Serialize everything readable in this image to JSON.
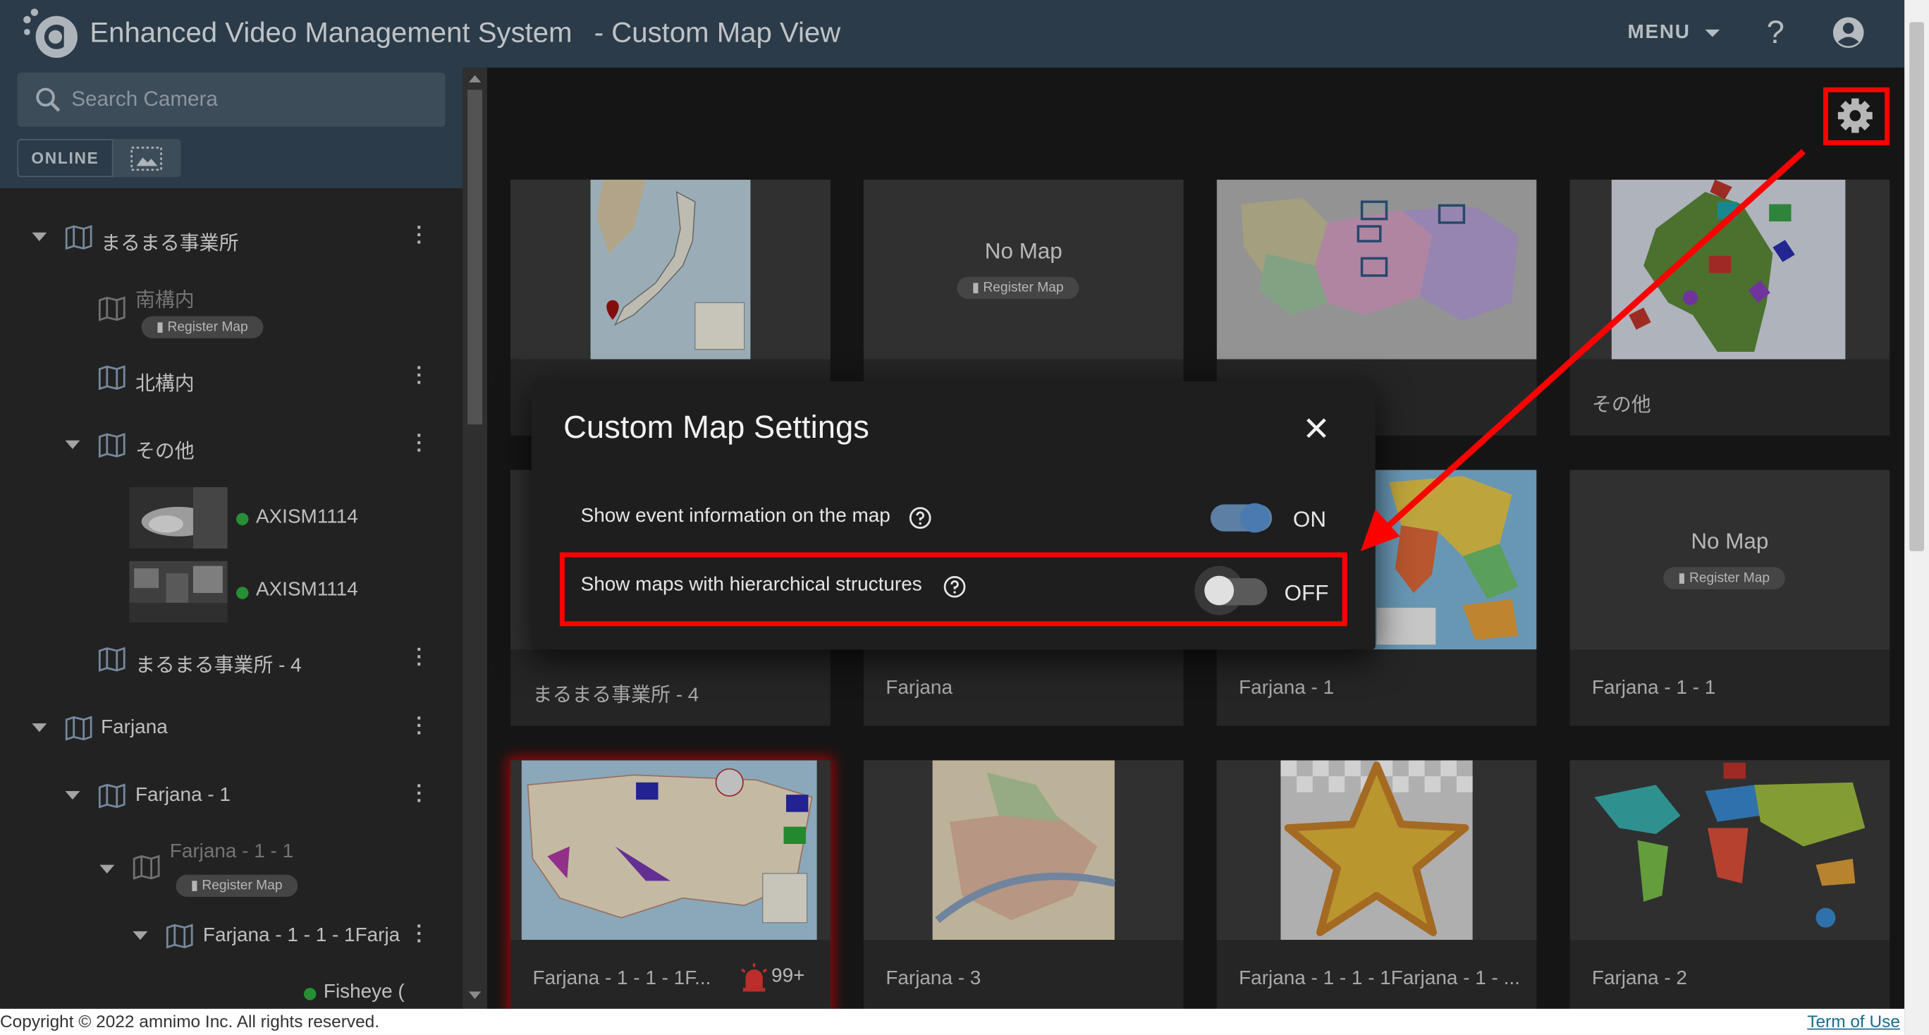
{
  "header": {
    "app_title": "Enhanced Video Management System",
    "page_subtitle": "- Custom Map View",
    "menu_label": "MENU",
    "help_label": "?",
    "brand_color": "#36495a"
  },
  "sidebar": {
    "search_placeholder": "Search Camera",
    "online_label": "ONLINE",
    "register_map_label": "Register Map",
    "tree": {
      "marumaru": "まるまる事業所",
      "minami": "南構内",
      "kita": "北構内",
      "sonota": "その他",
      "cam1": "AXISM1114",
      "cam2": "AXISM1114",
      "marumaru4": "まるまる事業所 - 4",
      "farjana": "Farjana",
      "farjana1": "Farjana - 1",
      "farjana11": "Farjana - 1 - 1",
      "farjana111": "Farjana - 1 - 1 - 1Farja",
      "fisheye": "Fisheye ("
    }
  },
  "grid": {
    "no_map_label": "No Map",
    "register_map_label": "Register Map",
    "cards": [
      {
        "label": ""
      },
      {
        "label": ""
      },
      {
        "label": ""
      },
      {
        "label": "その他"
      },
      {
        "label": "まるまる事業所 - 4"
      },
      {
        "label": "Farjana"
      },
      {
        "label": "Farjana - 1"
      },
      {
        "label": "Farjana - 1 - 1"
      },
      {
        "label": "Farjana - 1 - 1 - 1F...",
        "badge": "99+"
      },
      {
        "label": "Farjana - 3"
      },
      {
        "label": "Farjana - 1 - 1 - 1Farjana - 1 - ..."
      },
      {
        "label": "Farjana - 2"
      }
    ]
  },
  "dialog": {
    "title": "Custom Map Settings",
    "option1_label": "Show event information on the map",
    "option1_state": "ON",
    "option2_label": "Show maps with hierarchical structures",
    "option2_state": "OFF"
  },
  "footer": {
    "copyright": "Copyright © 2022 amnimo Inc. All rights reserved.",
    "terms": "Term of Use"
  },
  "colors": {
    "highlight": "#ff0000",
    "online_dot": "#2fb040",
    "toggle_on": "#5c7fa3"
  }
}
